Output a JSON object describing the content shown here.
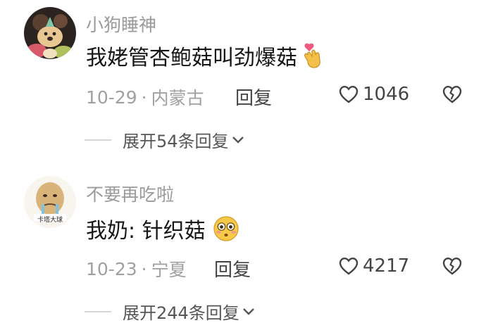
{
  "comments": [
    {
      "username": "小狗睡神",
      "text": "我姥管杏鲍菇叫劲爆菇",
      "emoji": "finger-heart-emoji",
      "date": "10-29",
      "location": "内蒙古",
      "reply_label": "回复",
      "likes": "1046",
      "expand_label": "展开54条回复"
    },
    {
      "username": "不要再吃啦",
      "avatar_caption": "卡塔大球",
      "text": "我奶: 针织菇",
      "emoji": "flushed-face-emoji",
      "date": "10-23",
      "location": "宁夏",
      "reply_label": "回复",
      "likes": "4217",
      "expand_label": "展开244条回复"
    }
  ],
  "separator": "·",
  "colors": {
    "username": "#9a9a9a",
    "text": "#161616",
    "meta": "#a0a0a0",
    "heart_emoji": "#f05a7e",
    "hand_emoji": "#f3c04a"
  }
}
